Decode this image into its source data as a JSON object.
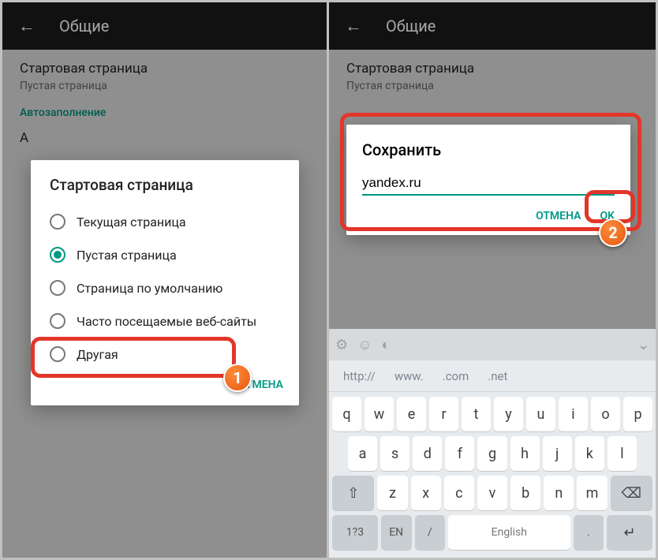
{
  "colors": {
    "accent": "#009986",
    "highlight": "#e3362a",
    "badge": "#e55a12"
  },
  "topbar": {
    "title": "Общие"
  },
  "settings": {
    "start_page_label": "Стартовая страница",
    "start_page_value": "Пустая страница",
    "autofill_header": "Автозаполнение",
    "row2_label": "А"
  },
  "dialog_left": {
    "title": "Стартовая страница",
    "options": [
      {
        "label": "Текущая страница",
        "checked": false
      },
      {
        "label": "Пустая страница",
        "checked": true
      },
      {
        "label": "Страница по умолчанию",
        "checked": false
      },
      {
        "label": "Часто посещаемые веб-сайты",
        "checked": false
      },
      {
        "label": "Другая",
        "checked": false
      }
    ],
    "cancel": "ОТМЕНА"
  },
  "dialog_right": {
    "title": "Сохранить",
    "input_value": "yandex.ru",
    "cancel": "ОТМЕНА",
    "ok": "OK"
  },
  "badges": {
    "one": "1",
    "two": "2"
  },
  "keyboard": {
    "suggestions": [
      "http://",
      "www.",
      ".com",
      ".net"
    ],
    "row1": [
      "q",
      "w",
      "e",
      "r",
      "t",
      "y",
      "u",
      "i",
      "o",
      "p"
    ],
    "row2": [
      "a",
      "s",
      "d",
      "f",
      "g",
      "h",
      "j",
      "k",
      "l"
    ],
    "row3_mid": [
      "z",
      "x",
      "c",
      "v",
      "b",
      "n",
      "m"
    ],
    "fn_numsym": "1?3",
    "fn_lang": "EN",
    "fn_slash": "/",
    "space": "English",
    "fn_dot": ".",
    "top_icons": [
      "gear-icon",
      "smile-icon",
      "globe-icon"
    ]
  }
}
